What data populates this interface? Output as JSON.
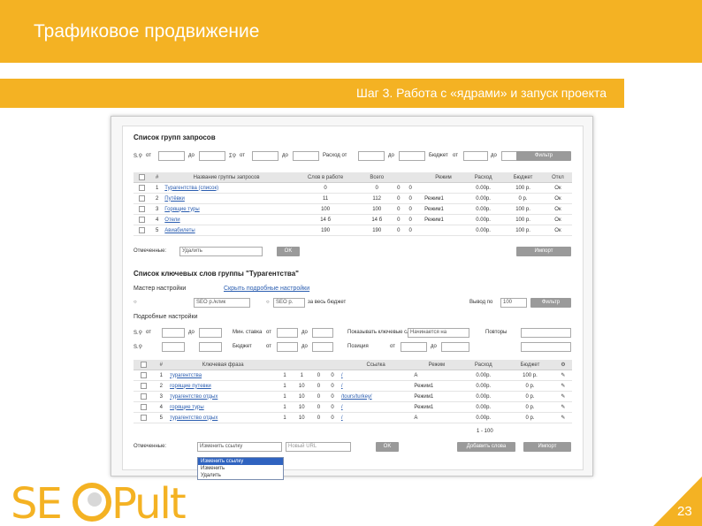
{
  "slide": {
    "title": "Трафиковое продвижение",
    "step": "Шаг 3. Работа с «ядрами» и запуск проекта",
    "page_number": "23",
    "accent_color": "#f4b223"
  },
  "groups": {
    "title": "Список групп запросов",
    "filter": {
      "from1": "от",
      "to1": "до",
      "from2": "от",
      "to2": "до",
      "spend_label": "Расход от",
      "to3": "до",
      "budget_label": "Бюджет",
      "from3": "от",
      "to4": "до",
      "apply": "Фильтр"
    },
    "headers": [
      "",
      "#",
      "Название группы запросов",
      "Слов в работе",
      "Всего",
      "",
      "",
      "",
      "Режим",
      "Расход",
      "Бюджет",
      "Откл"
    ],
    "rows": [
      {
        "n": "1",
        "name": "Турагентства (список)",
        "work": "0",
        "total": "0",
        "a": "0",
        "b": "0",
        "mode": "",
        "spend": "0.00р.",
        "budget": "100 р.",
        "off": "Ок"
      },
      {
        "n": "2",
        "name": "Путёвки",
        "work": "11",
        "total": "112",
        "a": "0",
        "b": "0",
        "mode": "Режим1",
        "spend": "0.00р.",
        "budget": "0 р.",
        "off": "Ок"
      },
      {
        "n": "3",
        "name": "Горящие туры",
        "work": "100",
        "total": "100",
        "a": "0",
        "b": "0",
        "mode": "Режим1",
        "spend": "0.00р.",
        "budget": "100 р.",
        "off": "Ок"
      },
      {
        "n": "4",
        "name": "Отели",
        "work": "14 б",
        "total": "14 б",
        "a": "0",
        "b": "0",
        "mode": "Режим1",
        "spend": "0.00р.",
        "budget": "100 р.",
        "off": "Ок"
      },
      {
        "n": "5",
        "name": "Авиабилеты",
        "work": "190",
        "total": "190",
        "a": "0",
        "b": "0",
        "mode": "",
        "spend": "0.00р.",
        "budget": "100 р.",
        "off": "Ок"
      }
    ],
    "action_label": "Отмеченные:",
    "action_value": "Удалить",
    "ok": "OK",
    "import": "Импорт"
  },
  "keywords": {
    "title": "Список ключевых слов группы \"Турагентства\"",
    "master_label": "Мастер настройки",
    "master_link": "Скрыть подробные настройки",
    "radio1_value": "SEO р./клик",
    "radio2_value": "SEO р.",
    "radio2_suffix": "за весь бюджет",
    "output_label": "Вывод по",
    "output_value": "100",
    "apply": "Фильтр",
    "detail_label": "Подробные настройки",
    "filter": {
      "from": "от",
      "to": "до",
      "min_bid": "Мин. ставка",
      "from2": "от",
      "to2": "до",
      "budget": "Бюджет",
      "from3": "от",
      "to3": "до",
      "phrase_label": "Показывать ключевые слова",
      "phrase_value": "Начинается на",
      "repeat_label": "Повторы",
      "position_label": "Позиция",
      "from4": "от",
      "to4": "до"
    },
    "headers": [
      "",
      "#",
      "Ключевая фраза",
      "",
      "",
      "",
      "",
      "Ссылка",
      "Режим",
      "Расход",
      "Бюджет",
      ""
    ],
    "rows": [
      {
        "n": "1",
        "phrase": "турагентства",
        "a": "1",
        "b": "1",
        "c": "0",
        "d": "0",
        "link": "/",
        "mode": "А",
        "spend": "0.00р.",
        "budget": "100 р."
      },
      {
        "n": "2",
        "phrase": "горящие путевки",
        "a": "1",
        "b": "10",
        "c": "0",
        "d": "0",
        "link": "/",
        "mode": "Режим1",
        "spend": "0.00р.",
        "budget": "0 р."
      },
      {
        "n": "3",
        "phrase": "турагентство отдых",
        "a": "1",
        "b": "10",
        "c": "0",
        "d": "0",
        "link": "/tours/turkey/",
        "mode": "Режим1",
        "spend": "0.00р.",
        "budget": "0 р."
      },
      {
        "n": "4",
        "phrase": "горящие туры",
        "a": "1",
        "b": "10",
        "c": "0",
        "d": "0",
        "link": "/",
        "mode": "Режим1",
        "spend": "0.00р.",
        "budget": "0 р."
      },
      {
        "n": "5",
        "phrase": "турагентство отдых",
        "a": "1",
        "b": "10",
        "c": "0",
        "d": "0",
        "link": "/",
        "mode": "А",
        "spend": "0.00р.",
        "budget": "0 р."
      }
    ],
    "pager": "1 - 100",
    "action_label": "Отмеченные:",
    "action_value": "Изменить ссылку",
    "url_placeholder": "Новый URL",
    "ok": "OK",
    "add_words": "Добавить слова",
    "import": "Импорт",
    "dropdown_options": [
      "Изменить ссылку",
      "Изменить",
      "Удалить"
    ]
  }
}
